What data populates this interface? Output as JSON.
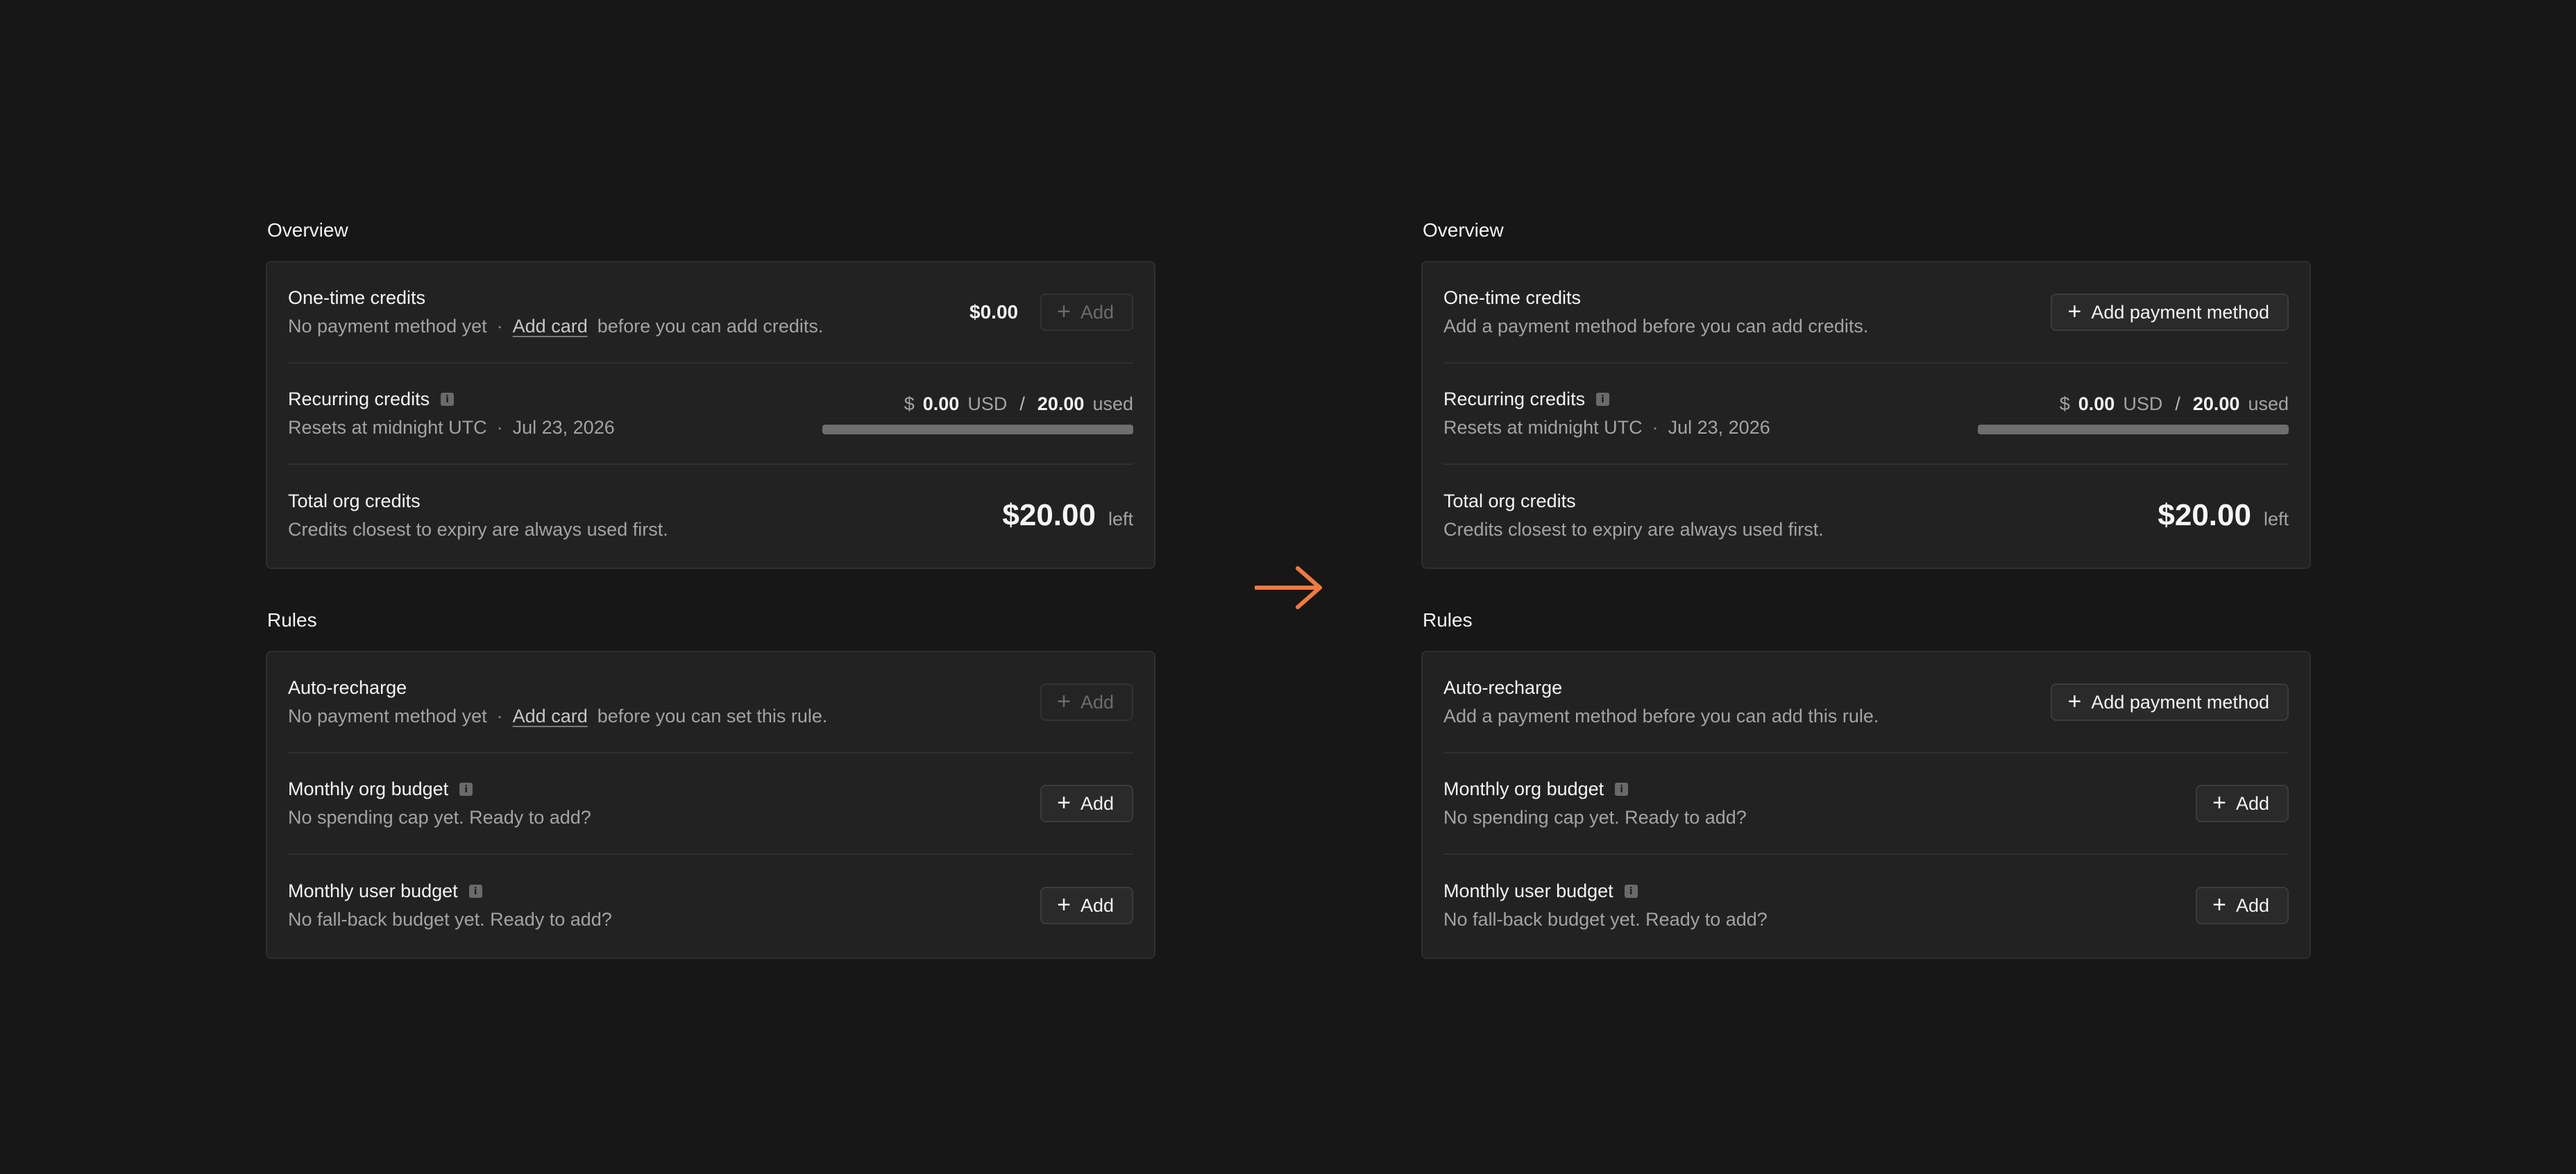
{
  "colors": {
    "background": "#171717",
    "card": "#222222",
    "accent_arrow": "#f07a3e"
  },
  "before": {
    "overview_title": "Overview",
    "one_time": {
      "title": "One-time credits",
      "sub_prefix": "No payment method yet",
      "sub_dot": "·",
      "sub_link": "Add card",
      "sub_suffix": "before you can add credits.",
      "amount": "$0.00",
      "button_label": "Add"
    },
    "recurring": {
      "title": "Recurring credits",
      "info": "i",
      "sub_prefix": "Resets at midnight UTC",
      "sub_dot": "·",
      "sub_date": "Jul 23, 2026",
      "currency_symbol": "$",
      "used_amount": "0.00",
      "currency": "USD",
      "slash": "/",
      "limit": "20.00",
      "used_label": "used",
      "progress": 0
    },
    "total": {
      "title": "Total org credits",
      "sub": "Credits closest to expiry are always used first.",
      "amount": "$20.00",
      "suffix": "left"
    },
    "rules_title": "Rules",
    "auto_recharge": {
      "title": "Auto-recharge",
      "sub_prefix": "No payment method yet",
      "sub_dot": "·",
      "sub_link": "Add card",
      "sub_suffix": "before you can set this rule.",
      "button_label": "Add"
    },
    "org_budget": {
      "title": "Monthly org budget",
      "info": "i",
      "sub": "No spending cap yet. Ready to add?",
      "button_label": "Add"
    },
    "user_budget": {
      "title": "Monthly user budget",
      "info": "i",
      "sub": "No fall-back budget yet. Ready to add?",
      "button_label": "Add"
    }
  },
  "after": {
    "overview_title": "Overview",
    "one_time": {
      "title": "One-time credits",
      "sub": "Add a payment method before you can add credits.",
      "button_label": "Add payment method"
    },
    "recurring": {
      "title": "Recurring credits",
      "info": "i",
      "sub_prefix": "Resets at midnight UTC",
      "sub_dot": "·",
      "sub_date": "Jul 23, 2026",
      "currency_symbol": "$",
      "used_amount": "0.00",
      "currency": "USD",
      "slash": "/",
      "limit": "20.00",
      "used_label": "used",
      "progress": 0
    },
    "total": {
      "title": "Total org credits",
      "sub": "Credits closest to expiry are always used first.",
      "amount": "$20.00",
      "suffix": "left"
    },
    "rules_title": "Rules",
    "auto_recharge": {
      "title": "Auto-recharge",
      "sub": "Add a payment method before you can add this rule.",
      "button_label": "Add payment method"
    },
    "org_budget": {
      "title": "Monthly org budget",
      "info": "i",
      "sub": "No spending cap yet. Ready to add?",
      "button_label": "Add"
    },
    "user_budget": {
      "title": "Monthly user budget",
      "info": "i",
      "sub": "No fall-back budget yet. Ready to add?",
      "button_label": "Add"
    }
  },
  "arrow_icon": "arrow-right-icon",
  "button_icon": "plus-icon",
  "plus_glyph": "+"
}
